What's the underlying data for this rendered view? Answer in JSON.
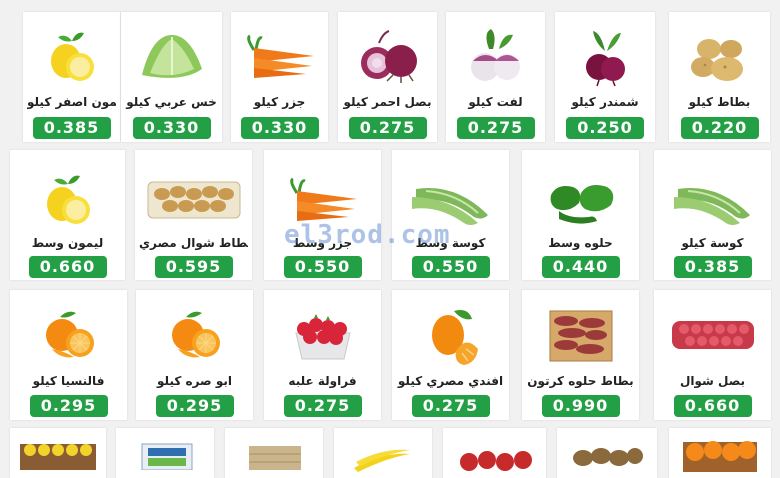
{
  "watermark": "el3rod.com",
  "colors": {
    "price_bg": "#23a045",
    "page_bg": "#f1f1f1"
  },
  "products": [
    {
      "name": "ليمون اصفر كيلو",
      "price": "0.385",
      "icon": "lemon"
    },
    {
      "name": "خس عربي كيلو",
      "price": "0.330",
      "icon": "lettuce"
    },
    {
      "name": "جزر كيلو",
      "price": "0.330",
      "icon": "carrot"
    },
    {
      "name": "بصل احمر كيلو",
      "price": "0.275",
      "icon": "red-onion"
    },
    {
      "name": "لفت كيلو",
      "price": "0.275",
      "icon": "turnip"
    },
    {
      "name": "شمندر كيلو",
      "price": "0.250",
      "icon": "beetroot"
    },
    {
      "name": "بطاط كيلو",
      "price": "0.220",
      "icon": "potato"
    },
    {
      "name": "ليمون وسط",
      "price": "0.660",
      "icon": "lemon"
    },
    {
      "name": "بطاط شوال مصري",
      "price": "0.595",
      "icon": "potato-sack"
    },
    {
      "name": "جزر وسط",
      "price": "0.550",
      "icon": "carrot"
    },
    {
      "name": "كوسة وسط",
      "price": "0.550",
      "icon": "zucchini"
    },
    {
      "name": "حلوه وسط",
      "price": "0.440",
      "icon": "green-pepper"
    },
    {
      "name": "كوسة كيلو",
      "price": "0.385",
      "icon": "zucchini"
    },
    {
      "name": "فالنسيا كيلو",
      "price": "0.295",
      "icon": "orange"
    },
    {
      "name": "ابو صره كيلو",
      "price": "0.295",
      "icon": "orange"
    },
    {
      "name": "فراولة علبه",
      "price": "0.275",
      "icon": "strawberry"
    },
    {
      "name": "افندي مصري كيلو",
      "price": "0.275",
      "icon": "tangerine"
    },
    {
      "name": "بطاط حلوه كرتون",
      "price": "0.990",
      "icon": "sweet-potato-box"
    },
    {
      "name": "بصل شوال",
      "price": "0.660",
      "icon": "onion-sack"
    },
    {
      "icon": "lemon-crate"
    },
    {
      "icon": "produce-box"
    },
    {
      "icon": "crate"
    },
    {
      "icon": "banana"
    },
    {
      "icon": "apple"
    },
    {
      "icon": "kiwi"
    },
    {
      "icon": "orange-crate"
    }
  ]
}
